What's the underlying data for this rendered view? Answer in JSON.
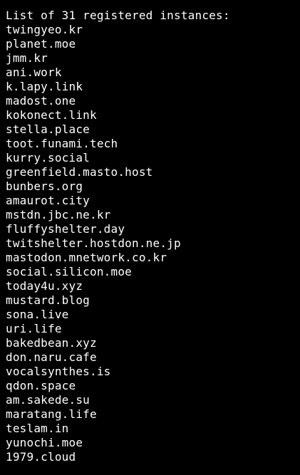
{
  "terminal": {
    "header": "List of 31 registered instances:",
    "instances": [
      "twingyeo.kr",
      "planet.moe",
      "jmm.kr",
      "ani.work",
      "k.lapy.link",
      "madost.one",
      "kokonect.link",
      "stella.place",
      "toot.funami.tech",
      "kurry.social",
      "greenfield.masto.host",
      "bunbers.org",
      "amaurot.city",
      "mstdn.jbc.ne.kr",
      "fluffyshelter.day",
      "twitshelter.hostdon.ne.jp",
      "mastodon.mnetwork.co.kr",
      "social.silicon.moe",
      "today4u.xyz",
      "mustard.blog",
      "sona.live",
      "uri.life",
      "bakedbean.xyz",
      "don.naru.cafe",
      "vocalsynthes.is",
      "qdon.space",
      "am.sakede.su",
      "maratang.life",
      "teslam.in",
      "yunochi.moe",
      "1979.cloud"
    ]
  },
  "colors": {
    "background": "#000000",
    "text": "#ffffff"
  }
}
